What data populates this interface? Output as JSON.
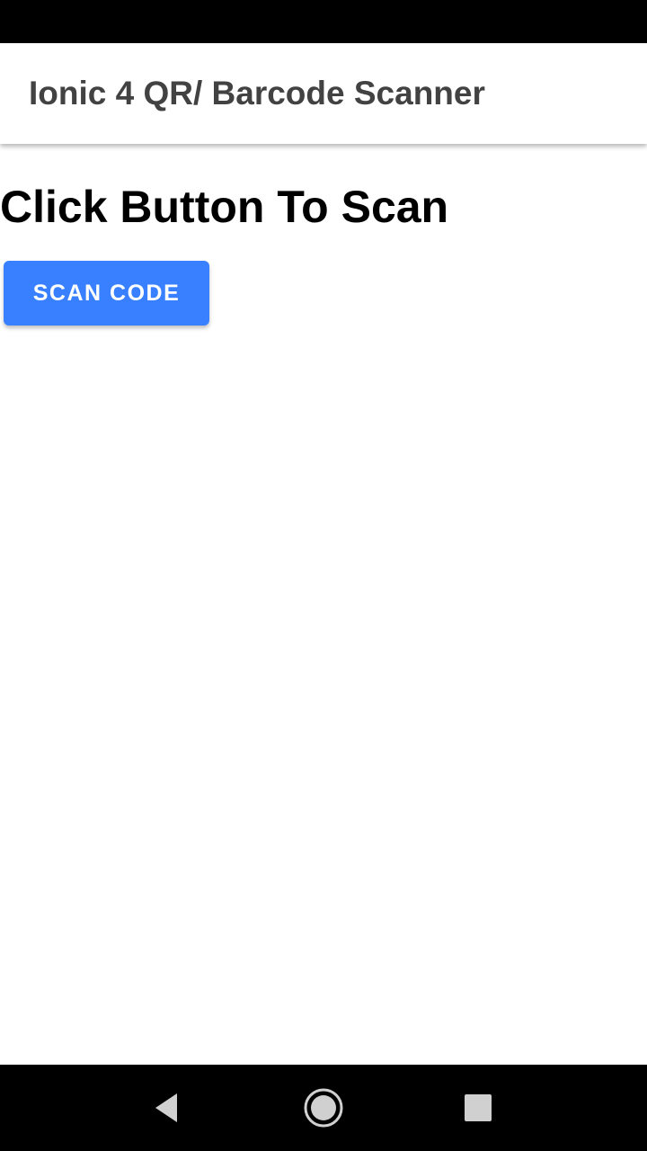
{
  "toolbar": {
    "title": "Ionic 4 QR/ Barcode Scanner"
  },
  "main": {
    "heading": "Click Button To Scan",
    "scan_button_label": "SCAN CODE",
    "accent_color": "#3880ff"
  },
  "navigation": {
    "icons": [
      "back-icon",
      "home-icon",
      "recents-icon"
    ]
  }
}
